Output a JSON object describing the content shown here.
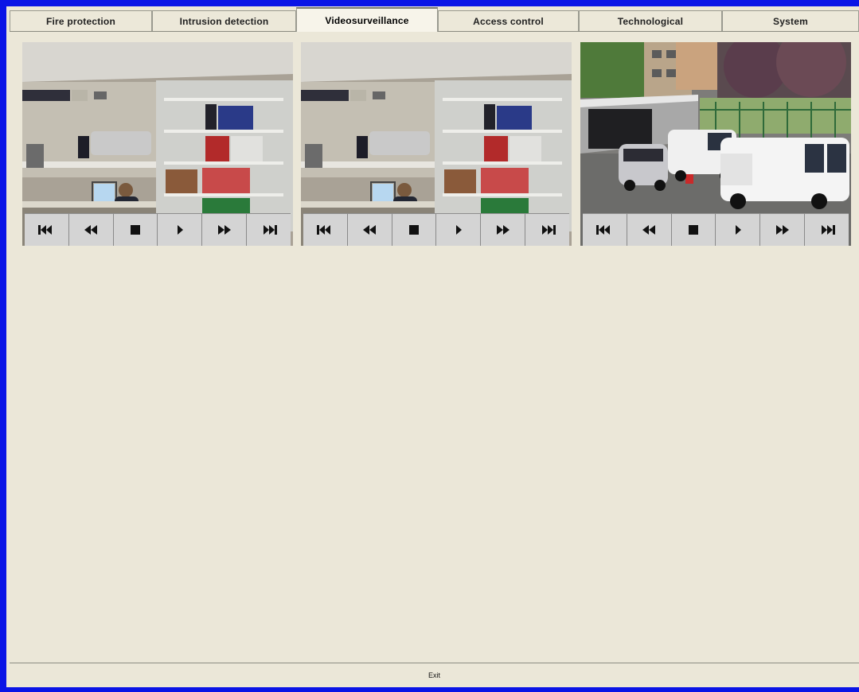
{
  "tabs": [
    {
      "label": "Fire protection",
      "active": false
    },
    {
      "label": "Intrusion detection",
      "active": false
    },
    {
      "label": "Videosurveillance",
      "active": true
    },
    {
      "label": "Access control",
      "active": false
    },
    {
      "label": "Technological",
      "active": false
    },
    {
      "label": "System",
      "active": false
    }
  ],
  "cameras": [
    {
      "scene": "office",
      "controls": [
        "skip-back-icon",
        "rewind-icon",
        "stop-icon",
        "play-icon",
        "fast-forward-icon",
        "skip-forward-icon"
      ]
    },
    {
      "scene": "office",
      "controls": [
        "skip-back-icon",
        "rewind-icon",
        "stop-icon",
        "play-icon",
        "fast-forward-icon",
        "skip-forward-icon"
      ]
    },
    {
      "scene": "parking-lot",
      "controls": [
        "skip-back-icon",
        "rewind-icon",
        "stop-icon",
        "play-icon",
        "fast-forward-icon",
        "skip-forward-icon"
      ]
    }
  ],
  "footer": {
    "exit_label": "Exit"
  },
  "colors": {
    "frame": "#0a14e6",
    "background": "#ebe7d8",
    "control_bar": "#d4d4d4"
  }
}
